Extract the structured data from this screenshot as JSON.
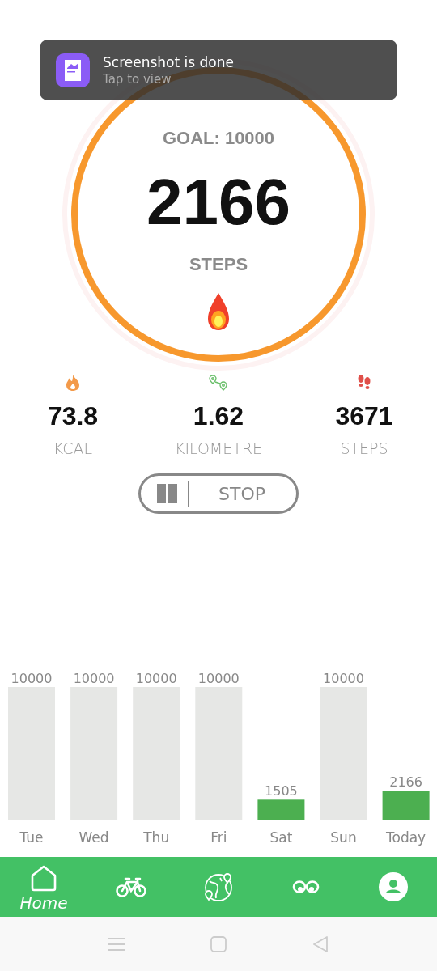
{
  "notification": {
    "title": "Screenshot is done",
    "subtitle": "Tap to view"
  },
  "goal": {
    "label": "GOAL: 10000",
    "count": "2166",
    "unit": "STEPS"
  },
  "stats": [
    {
      "kind": "flame",
      "value": "73.8",
      "unit": "KCAL"
    },
    {
      "kind": "route",
      "value": "1.62",
      "unit": "KILOMETRE"
    },
    {
      "kind": "footprints",
      "value": "3671",
      "unit": "STEPS"
    }
  ],
  "control": {
    "stop_label": "STOP"
  },
  "history": {
    "chart_data": {
      "type": "bar",
      "categories": [
        "Tue",
        "Wed",
        "Thu",
        "Fri",
        "Sat",
        "Sun",
        "Today"
      ],
      "ylim": [
        0,
        10000
      ],
      "data_labels": true,
      "series": [
        {
          "color": "#e6e7e5",
          "values": [
            10000,
            10000,
            10000,
            10000,
            null,
            10000,
            null
          ]
        },
        {
          "color": "#4caf50",
          "values": [
            null,
            null,
            null,
            null,
            1505,
            null,
            2166
          ]
        }
      ]
    }
  },
  "nav": [
    {
      "kind": "home",
      "label": "Home",
      "selected": true
    },
    {
      "kind": "bike",
      "selected": false
    },
    {
      "kind": "globe",
      "selected": false
    },
    {
      "kind": "eyes",
      "selected": false
    },
    {
      "kind": "profile",
      "selected": false
    }
  ]
}
